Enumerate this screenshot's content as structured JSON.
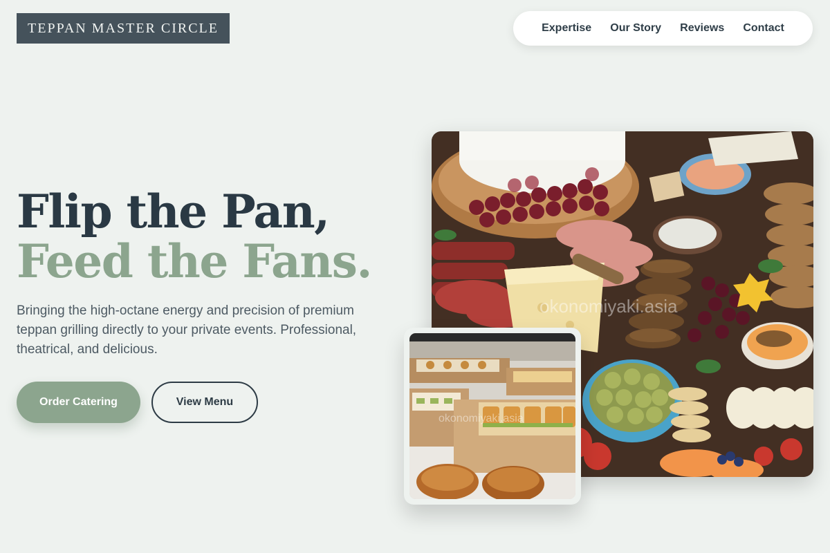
{
  "brand": {
    "logo_text": "TEPPAN MASTER CIRCLE"
  },
  "nav": {
    "items": [
      {
        "label": "Expertise"
      },
      {
        "label": "Our Story"
      },
      {
        "label": "Reviews"
      },
      {
        "label": "Contact"
      }
    ]
  },
  "hero": {
    "headline_line1": "Flip the Pan,",
    "headline_line2": "Feed the Fans.",
    "lede": "Bringing the high-octane energy and precision of premium teppan grilling directly to your private events. Professional, theatrical, and delicious.",
    "primary_cta": "Order Catering",
    "secondary_cta": "View Menu"
  },
  "images": {
    "main_watermark": "okonomiyaki.asia",
    "thumb_watermark": "okonomiyaki.asia"
  },
  "colors": {
    "page_bg": "#eef2ef",
    "dark_slate": "#2d3b45",
    "sage_accent": "#8ca58e",
    "logo_bg": "#45525b"
  }
}
